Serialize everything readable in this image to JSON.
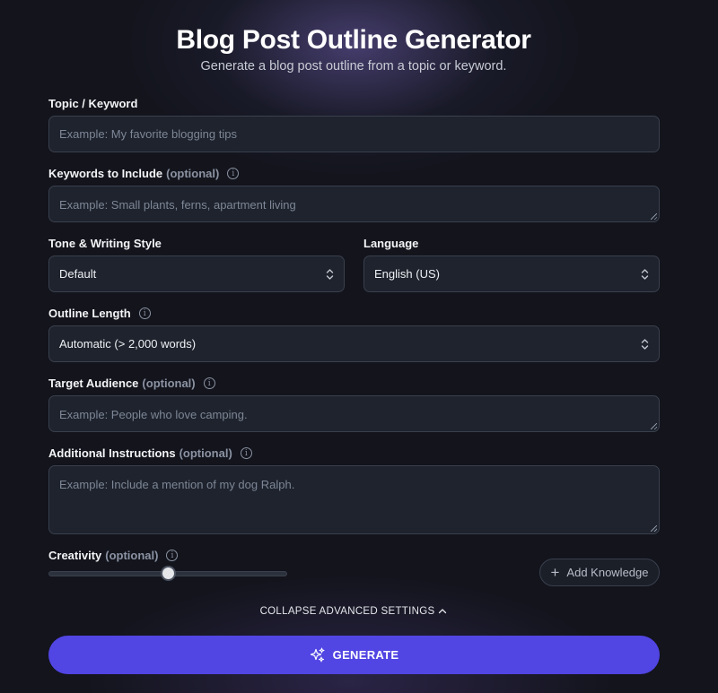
{
  "header": {
    "title": "Blog Post Outline Generator",
    "subtitle": "Generate a blog post outline from a topic or keyword."
  },
  "form": {
    "topic": {
      "label": "Topic / Keyword",
      "placeholder": "Example: My favorite blogging tips"
    },
    "keywords": {
      "label": "Keywords to Include",
      "optional": "(optional)",
      "placeholder": "Example: Small plants, ferns, apartment living"
    },
    "tone": {
      "label": "Tone & Writing Style",
      "value": "Default"
    },
    "language": {
      "label": "Language",
      "value": "English (US)"
    },
    "outline_length": {
      "label": "Outline Length",
      "value": "Automatic (> 2,000 words)"
    },
    "audience": {
      "label": "Target Audience",
      "optional": "(optional)",
      "placeholder": "Example: People who love camping."
    },
    "instructions": {
      "label": "Additional Instructions",
      "optional": "(optional)",
      "placeholder": "Example: Include a mention of my dog Ralph."
    },
    "creativity": {
      "label": "Creativity",
      "optional": "(optional)",
      "level": 0.5
    }
  },
  "actions": {
    "add_knowledge": "Add Knowledge",
    "collapse": "COLLAPSE ADVANCED SETTINGS",
    "generate": "GENERATE"
  },
  "colors": {
    "accent": "#5145e3",
    "background": "#13141c",
    "field": "#1e232d"
  },
  "icons": {
    "info": "info-icon",
    "select": "chevron-up-down-icon",
    "plus": "plus-icon",
    "collapse": "chevron-up-icon",
    "generate": "sparkles-icon"
  }
}
